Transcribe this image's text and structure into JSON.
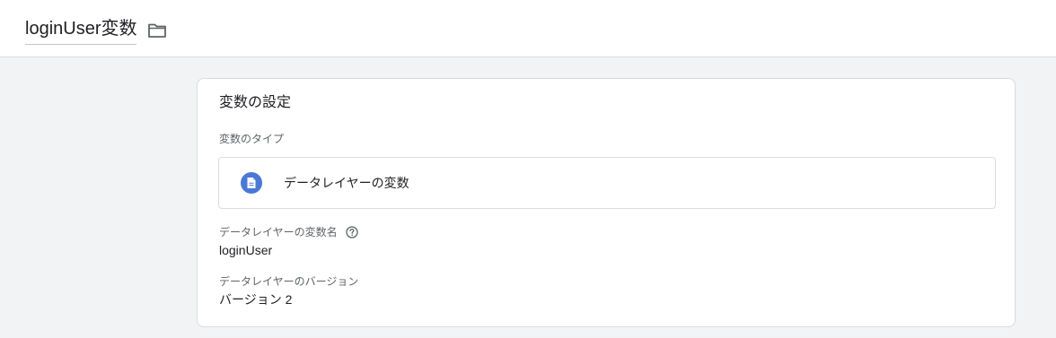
{
  "header": {
    "title": "loginUser変数",
    "folder_icon": "folder-icon"
  },
  "card": {
    "title": "変数の設定",
    "variable_type": {
      "label": "変数のタイプ",
      "value": "データレイヤーの変数",
      "icon": "document-icon",
      "icon_color": "#4a78d6"
    },
    "variable_name": {
      "label": "データレイヤーの変数名",
      "help_icon": "help-icon",
      "value": "loginUser"
    },
    "version": {
      "label": "データレイヤーのバージョン",
      "value": "バージョン 2"
    }
  }
}
